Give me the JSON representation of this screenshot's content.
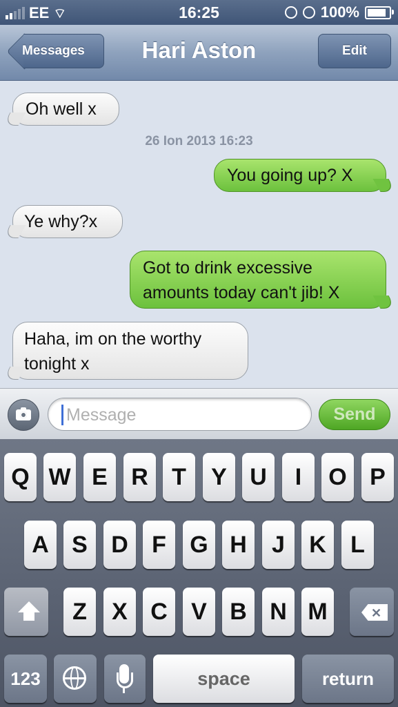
{
  "status_bar": {
    "carrier": "EE",
    "time": "16:25",
    "battery": "100%"
  },
  "nav": {
    "back_label": "Messages",
    "title": "Hari Aston",
    "edit_label": "Edit"
  },
  "messages": [
    {
      "direction": "in",
      "text": "Oh well x"
    },
    {
      "direction": "out",
      "text": "You going up? X"
    },
    {
      "direction": "in",
      "text": "Ye why?x"
    },
    {
      "direction": "out",
      "text": "Got to drink excessive amounts today can't jib! X"
    },
    {
      "direction": "in",
      "text": "Haha, im on the worthy tonight x"
    }
  ],
  "timestamp": "26 Ion 2013 16:23",
  "composer": {
    "placeholder": "Message",
    "send_label": "Send"
  },
  "keyboard": {
    "row1": [
      "Q",
      "W",
      "E",
      "R",
      "T",
      "Y",
      "U",
      "I",
      "O",
      "P"
    ],
    "row2": [
      "A",
      "S",
      "D",
      "F",
      "G",
      "H",
      "J",
      "K",
      "L"
    ],
    "row3": [
      "Z",
      "X",
      "C",
      "V",
      "B",
      "N",
      "M"
    ],
    "numbers_label": "123",
    "space_label": "space",
    "return_label": "return"
  },
  "colors": {
    "outgoing_bubble": "#7fcf4a",
    "incoming_bubble": "#f2f2f2",
    "nav_bar": "#8ea2bd",
    "send_button": "#5fb52f"
  }
}
